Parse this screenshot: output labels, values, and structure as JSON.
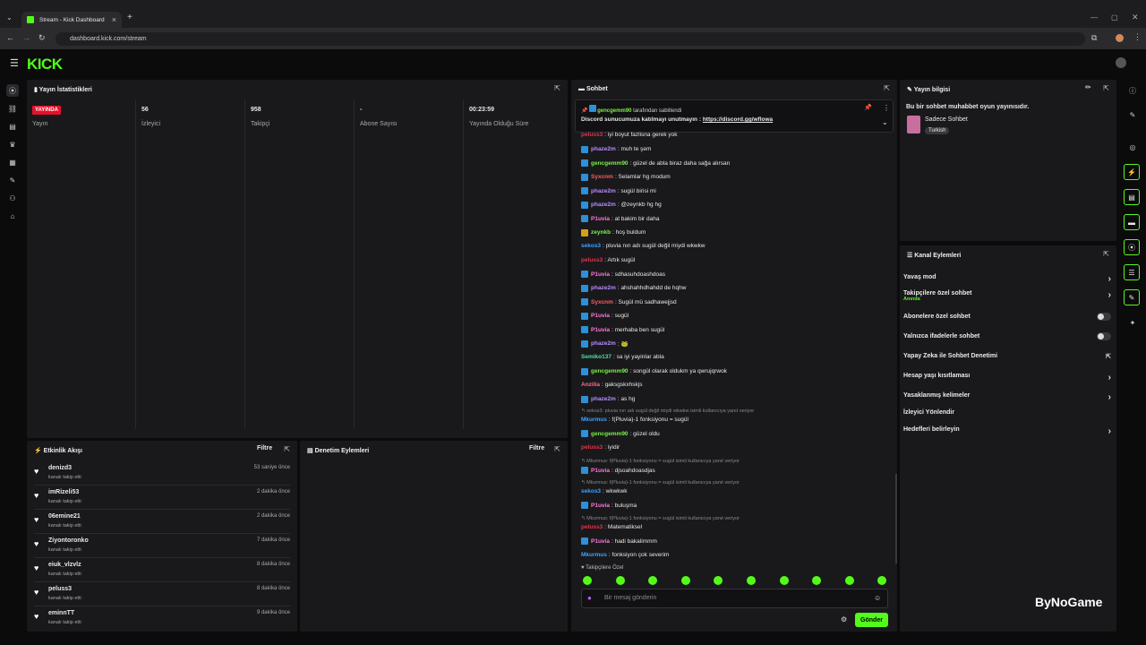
{
  "browser": {
    "tab_title": "Stream - Kick Dashboard",
    "url": "dashboard.kick.com/stream",
    "new_tab": "+",
    "close_tab": "×"
  },
  "app": {
    "logo": "KICK"
  },
  "stats": {
    "title": "Yayın İstatistikleri",
    "items": [
      {
        "value": "YAYINDA",
        "label": "Yayın"
      },
      {
        "value": "56",
        "label": "İzleyici"
      },
      {
        "value": "958",
        "label": "Takipçi"
      },
      {
        "value": "-",
        "label": "Abone Sayısı"
      },
      {
        "value": "00:23:59",
        "label": "Yayında Olduğu Süre"
      }
    ]
  },
  "activity": {
    "title": "Etkinlik Akışı",
    "filter": "Filtre",
    "items": [
      {
        "name": "denizd3",
        "sub": "kanalı takip etti",
        "time": "53 saniye önce"
      },
      {
        "name": "imRizeli53",
        "sub": "kanalı takip etti",
        "time": "2 dakika önce"
      },
      {
        "name": "06emine21",
        "sub": "kanalı takip etti",
        "time": "2 dakika önce"
      },
      {
        "name": "Ziyontoronko",
        "sub": "kanalı takip etti",
        "time": "7 dakika önce"
      },
      {
        "name": "eiuk_vlzvlz",
        "sub": "kanalı takip etti",
        "time": "8 dakika önce"
      },
      {
        "name": "peluss3",
        "sub": "kanalı takip etti",
        "time": "8 dakika önce"
      },
      {
        "name": "eminnTT",
        "sub": "kanalı takip etti",
        "time": "9 dakika önce"
      }
    ]
  },
  "moderation": {
    "title": "Denetim Eylemleri",
    "filter": "Filtre"
  },
  "chat": {
    "title": "Sohbet",
    "pinned": {
      "by": "gencgemm90",
      "by_suffix": "tarafından sabitlendi",
      "text": "Discord sunucumuza katılmayı unutmayın :",
      "link": "https://discord.gg/wflowa"
    },
    "messages": [
      {
        "user": "peluss3",
        "color": "#e5334b",
        "badge": "",
        "text": ": iyi boyut fazlisna gerek yok"
      },
      {
        "user": "phaze2m",
        "color": "#b78cff",
        "badge": "blue",
        "text": ": muh te şem"
      },
      {
        "user": "gencgemm90",
        "color": "#7cf04a",
        "badge": "blue",
        "text": ": güzel de abla biraz daha sağa alırsan"
      },
      {
        "user": "Syxcnm",
        "color": "#ff5c5c",
        "badge": "blue",
        "text": ": Selamlar hg modum"
      },
      {
        "user": "phaze2m",
        "color": "#b78cff",
        "badge": "blue",
        "text": ": sugül birisi mi"
      },
      {
        "user": "phaze2m",
        "color": "#b78cff",
        "badge": "blue",
        "text": ": @zeynkb hg hg"
      },
      {
        "user": "P1uvia",
        "color": "#ff7ad9",
        "badge": "blue",
        "text": ": at bakim bir daha"
      },
      {
        "user": "zeynkb",
        "color": "#7cf04a",
        "badge": "gold",
        "text": ": hoş buldum"
      },
      {
        "user": "sekos3",
        "color": "#3fa3ff",
        "badge": "",
        "text": ": pluvia nın adı sugül değil miydi wkwkw"
      },
      {
        "user": "peluss3",
        "color": "#e5334b",
        "badge": "",
        "text": ": Artık sugül"
      },
      {
        "user": "P1uvia",
        "color": "#ff7ad9",
        "badge": "blue",
        "text": ": sdhasuhdoashdoas"
      },
      {
        "user": "phaze2m",
        "color": "#b78cff",
        "badge": "blue",
        "text": ": ahshahhdhahdd de hqhw"
      },
      {
        "user": "Syxcnm",
        "color": "#ff5c5c",
        "badge": "blue",
        "text": ": Sugül mü sadhawejjsd"
      },
      {
        "user": "P1uvia",
        "color": "#ff7ad9",
        "badge": "blue",
        "text": ": sugül"
      },
      {
        "user": "P1uvia",
        "color": "#ff7ad9",
        "badge": "blue",
        "text": ": merhaba ben sugül"
      },
      {
        "user": "phaze2m",
        "color": "#b78cff",
        "badge": "blue",
        "text": ": 🐸"
      },
      {
        "user": "Semiko137",
        "color": "#4fe0a0",
        "badge": "",
        "text": ": sa iyi yayinlar abla"
      },
      {
        "user": "gencgemm90",
        "color": "#7cf04a",
        "badge": "blue",
        "text": ": songül olarak oldukm ya qwrujqrwok"
      },
      {
        "user": "Anzilia",
        "color": "#ff6b8a",
        "badge": "",
        "text": ": gaksgskxhskjs"
      },
      {
        "user": "phaze2m",
        "color": "#b78cff",
        "badge": "blue",
        "text": ": as hg"
      }
    ],
    "replies": [
      {
        "reply": "↰ sekos3: pluvia nın adı sugül değil miydi wkwkw isimli kullanıcıya yanıt veriyor",
        "user": "Mkurmus",
        "color": "#3fa3ff",
        "badge": "",
        "text": ": f(Pluvia)-1 fonksiyonu = sugül"
      },
      {
        "reply": "",
        "user": "gencgemm90",
        "color": "#7cf04a",
        "badge": "blue",
        "text": ": güzel oldu"
      },
      {
        "reply": "",
        "user": "peluss3",
        "color": "#e5334b",
        "badge": "",
        "text": ": iyidir"
      },
      {
        "reply": "↰ Mkurmus: f(Pluvia)-1 fonksiyonu = sugül isimli kullanıcıya yanıt veriyor",
        "user": "P1uvia",
        "color": "#ff7ad9",
        "badge": "blue",
        "text": ": djsoahdoasdjas"
      },
      {
        "reply": "↰ Mkurmus: f(Pluvia)-1 fonksiyonu = sugül isimli kullanıcıya yanıt veriyor",
        "user": "sekos3",
        "color": "#3fa3ff",
        "badge": "",
        "text": ": wkwkwk"
      },
      {
        "reply": "",
        "user": "P1uvia",
        "color": "#ff7ad9",
        "badge": "blue",
        "text": ": buluşma"
      },
      {
        "reply": "↰ Mkurmus: f(Pluvia)-1 fonksiyonu = sugül isimli kullanıcıya yanıt veriyor",
        "user": "peluss3",
        "color": "#e5334b",
        "badge": "",
        "text": ": Matematiksel"
      },
      {
        "reply": "",
        "user": "P1uvia",
        "color": "#ff7ad9",
        "badge": "blue",
        "text": ": hadi bakalimmm"
      },
      {
        "reply": "",
        "user": "Mkurmus",
        "color": "#3fa3ff",
        "badge": "",
        "text": ": fonksiyon çok severim"
      }
    ],
    "follower_only": "♥ Takipçilere Özel",
    "input_placeholder": "Bir mesaj gönderin",
    "send": "Gönder"
  },
  "stream_info": {
    "title": "Yayın bilgisi",
    "description": "Bu bir sohbet muhabbet oyun yayınısıdır.",
    "category": "Sadece Sohbet",
    "language": "Turkish"
  },
  "channel_actions": {
    "title": "Kanal Eylemleri",
    "items": [
      {
        "label": "Yavaş mod",
        "sub": "",
        "control": "chevron"
      },
      {
        "label": "Takipçilere özel sohbet",
        "sub": "Anında",
        "control": "chevron"
      },
      {
        "label": "Abonelere özel sohbet",
        "sub": "",
        "control": "toggle"
      },
      {
        "label": "Yalnızca ifadelerle sohbet",
        "sub": "",
        "control": "toggle"
      },
      {
        "label": "Yapay Zeka ile Sohbet Denetimi",
        "sub": "",
        "control": "external"
      },
      {
        "label": "Hesap yaşı kısıtlaması",
        "sub": "",
        "control": "chevron"
      },
      {
        "label": "Yasaklanmış kelimeler",
        "sub": "",
        "control": "chevron"
      },
      {
        "label": "İzleyici Yönlendir",
        "sub": "",
        "control": ""
      },
      {
        "label": "Hedefleri belirleyin",
        "sub": "",
        "control": "chevron"
      }
    ]
  },
  "watermark": "ByNoGame",
  "colors": {
    "accent": "#53fc18",
    "live": "#e5112b"
  }
}
